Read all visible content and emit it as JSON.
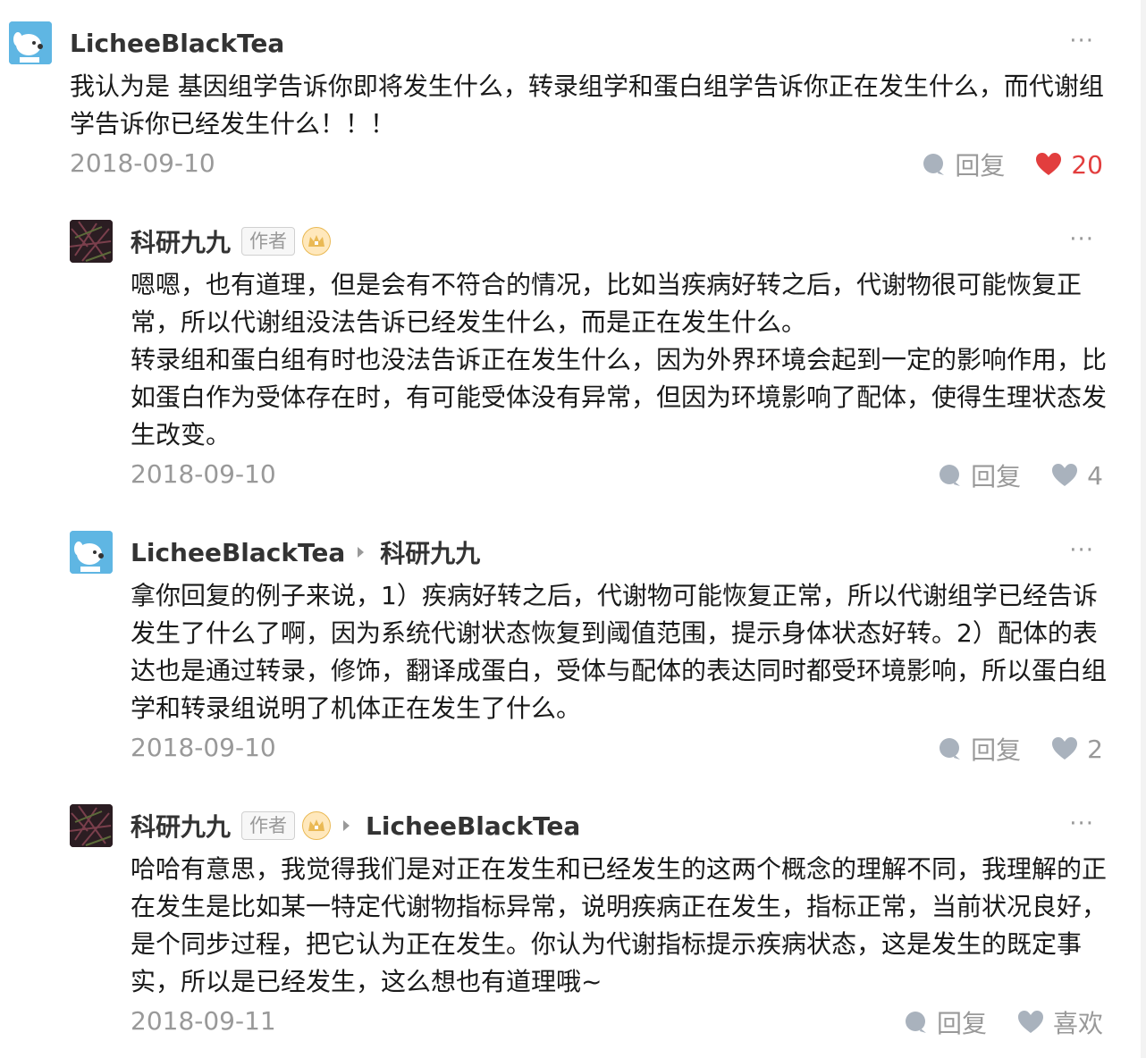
{
  "comments": [
    {
      "author": "LicheeBlackTea",
      "avatar": "dog-avatar-icon",
      "text": [
        "我认为是 基因组学告诉你即将发生什么，转录组学和蛋白组学告诉你正在发生什么，而代谢组学告诉你已经发生什么！！！"
      ],
      "date": "2018-09-10",
      "reply_label": "回复",
      "likes": "20",
      "liked": true
    },
    {
      "author": "科研九九",
      "author_tag": "作者",
      "avatar": "dark-texture-avatar",
      "text": [
        "嗯嗯，也有道理，但是会有不符合的情况，比如当疾病好转之后，代谢物很可能恢复正常，所以代谢组没法告诉已经发生什么，而是正在发生什么。",
        "转录组和蛋白组有时也没法告诉正在发生什么，因为外界环境会起到一定的影响作用，比如蛋白作为受体存在时，有可能受体没有异常，但因为环境影响了配体，使得生理状态发生改变。"
      ],
      "date": "2018-09-10",
      "reply_label": "回复",
      "likes": "4"
    },
    {
      "author": "LicheeBlackTea",
      "avatar": "dog-avatar-icon",
      "reply_to": "科研九九",
      "text": [
        "拿你回复的例子来说，1）疾病好转之后，代谢物可能恢复正常，所以代谢组学已经告诉发生了什么了啊，因为系统代谢状态恢复到阈值范围，提示身体状态好转。2）配体的表达也是通过转录，修饰，翻译成蛋白，受体与配体的表达同时都受环境影响，所以蛋白组学和转录组说明了机体正在发生了什么。"
      ],
      "date": "2018-09-10",
      "reply_label": "回复",
      "likes": "2"
    },
    {
      "author": "科研九九",
      "author_tag": "作者",
      "avatar": "dark-texture-avatar",
      "reply_to": "LicheeBlackTea",
      "text": [
        "哈哈有意思，我觉得我们是对正在发生和已经发生的这两个概念的理解不同，我理解的正在发生是比如某一特定代谢物指标异常，说明疾病正在发生，指标正常，当前状况良好，是个同步过程，把它认为正在发生。你认为代谢指标提示疾病状态，这是发生的既定事实，所以是已经发生，这么想也有道理哦~"
      ],
      "date": "2018-09-11",
      "reply_label": "回复",
      "likes": "喜欢"
    }
  ],
  "more_label": "···",
  "colors": {
    "like_active": "#e23e3e",
    "muted": "#999999",
    "crown": "#eab954"
  }
}
